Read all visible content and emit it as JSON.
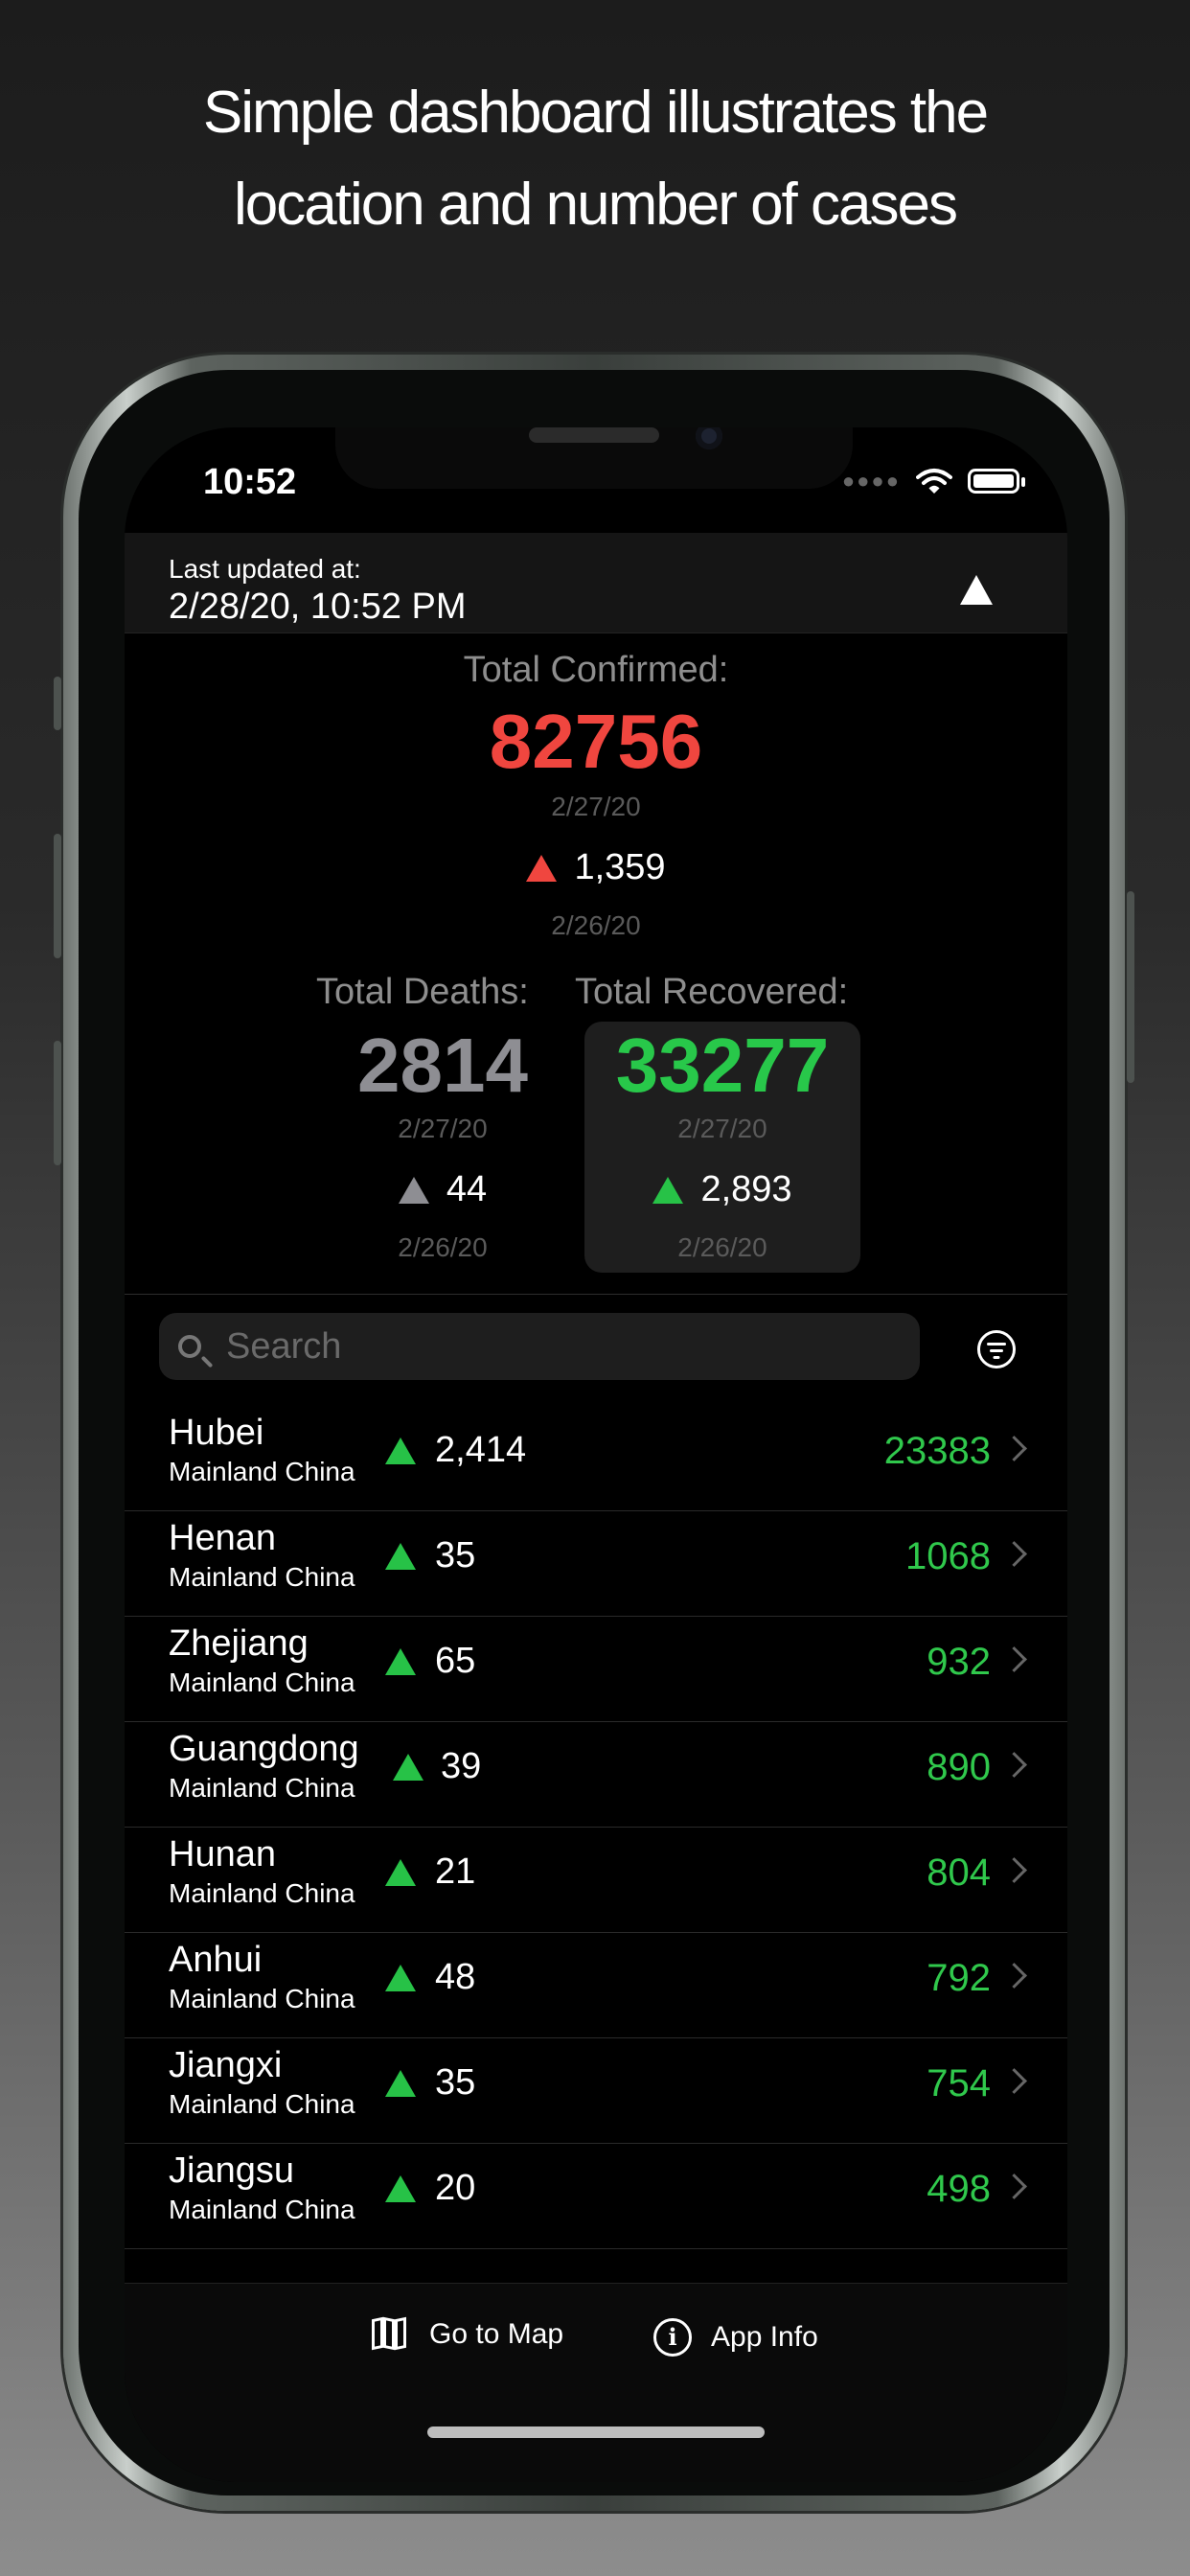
{
  "headline": [
    "Simple dashboard illustrates the",
    "location and number of  cases"
  ],
  "status_bar": {
    "time": "10:52"
  },
  "header": {
    "label": "Last updated at:",
    "date": "2/28/20, 10:52 PM"
  },
  "confirmed": {
    "label": "Total Confirmed:",
    "value": "82756",
    "date": "2/27/20",
    "delta": "1,359",
    "delta_date": "2/26/20"
  },
  "deaths": {
    "label": "Total Deaths:",
    "value": "2814",
    "date": "2/27/20",
    "delta": "44",
    "delta_date": "2/26/20"
  },
  "recovered": {
    "label": "Total Recovered:",
    "value": "33277",
    "date": "2/27/20",
    "delta": "2,893",
    "delta_date": "2/26/20"
  },
  "search": {
    "placeholder": "Search",
    "value": ""
  },
  "rows": [
    {
      "name": "Hubei",
      "sub": "Mainland China",
      "delta": "2,414",
      "value": "23383"
    },
    {
      "name": "Henan",
      "sub": "Mainland China",
      "delta": "35",
      "value": "1068"
    },
    {
      "name": "Zhejiang",
      "sub": "Mainland China",
      "delta": "65",
      "value": "932"
    },
    {
      "name": "Guangdong",
      "sub": "Mainland China",
      "delta": "39",
      "value": "890"
    },
    {
      "name": "Hunan",
      "sub": "Mainland China",
      "delta": "21",
      "value": "804"
    },
    {
      "name": "Anhui",
      "sub": "Mainland China",
      "delta": "48",
      "value": "792"
    },
    {
      "name": "Jiangxi",
      "sub": "Mainland China",
      "delta": "35",
      "value": "754"
    },
    {
      "name": "Jiangsu",
      "sub": "Mainland China",
      "delta": "20",
      "value": "498"
    }
  ],
  "tabs": {
    "map": "Go to Map",
    "info": "App Info"
  },
  "colors": {
    "confirmed": "#f0463f",
    "deaths": "#8e8e93",
    "recovered": "#28c84a",
    "up_green": "#27c247"
  }
}
